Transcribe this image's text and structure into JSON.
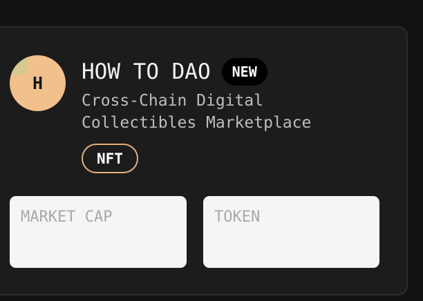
{
  "project": {
    "avatar_letter": "H",
    "title": "HOW TO DAO",
    "badge": "NEW",
    "description": "Cross-Chain Digital Collectibles Marketplace",
    "tag": "NFT"
  },
  "stats": {
    "market_cap_label": "MARKET CAP",
    "token_label": "TOKEN"
  },
  "colors": {
    "page_background": "#121212",
    "card_background": "#1c1c1c",
    "avatar": "#f2c08d",
    "tag_border": "#e4b07e",
    "stat_box": "#f5f5f5"
  }
}
